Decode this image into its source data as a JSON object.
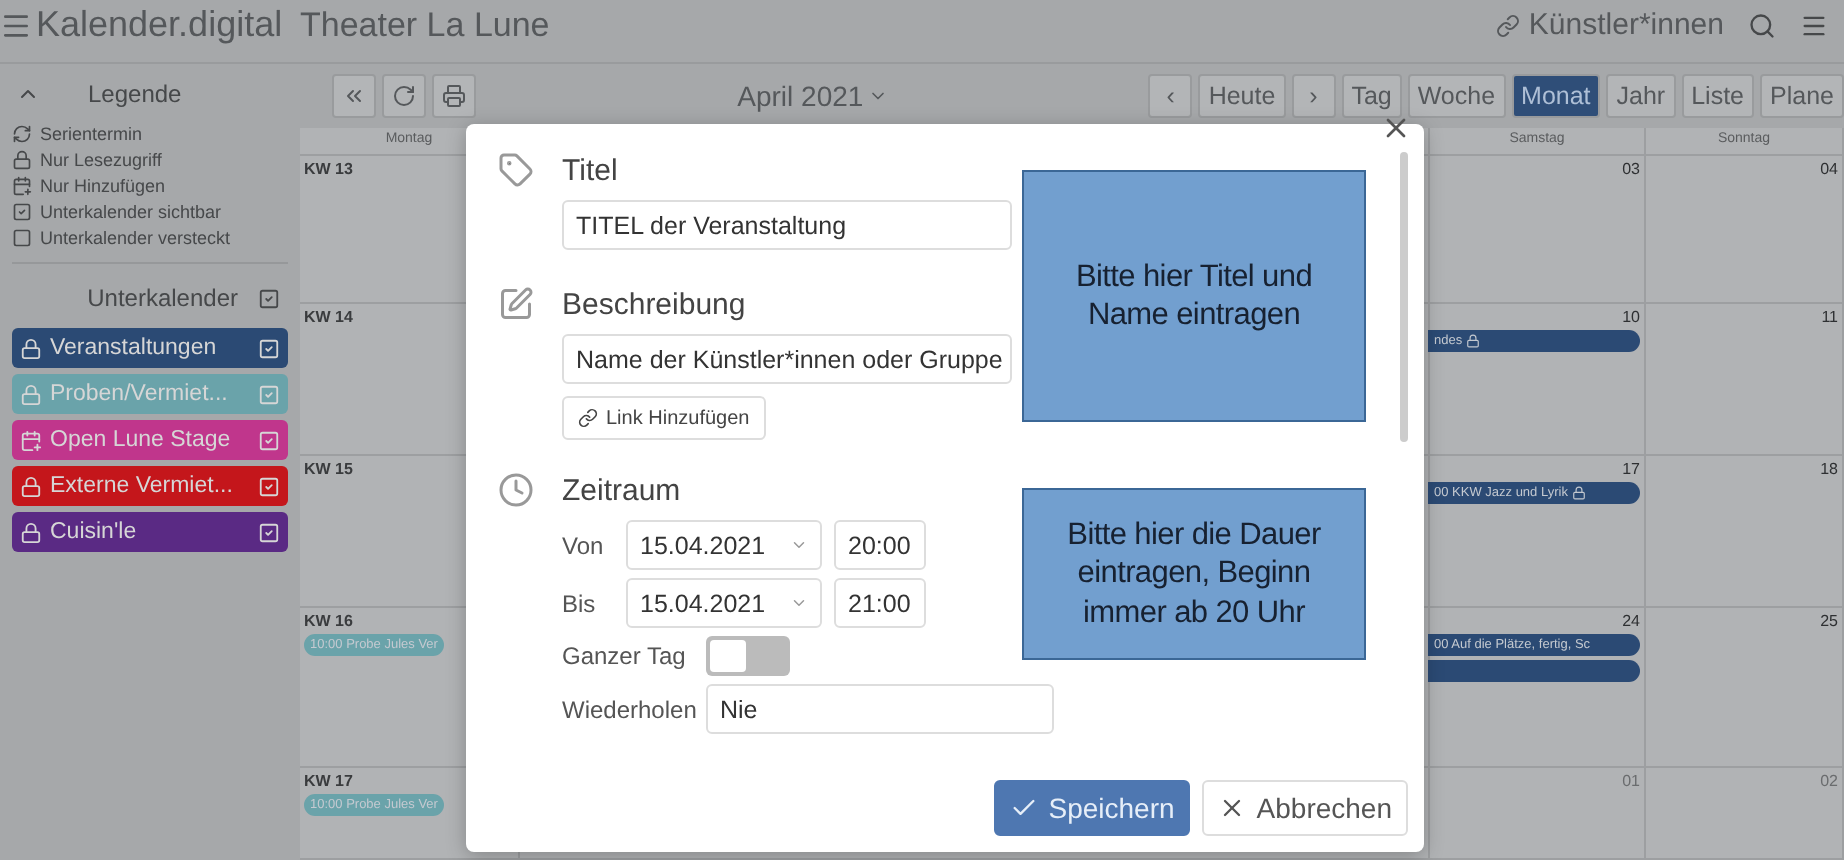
{
  "app": {
    "logo": "Kalender.digital",
    "calendar_name": "Theater La Lune",
    "user_link": "Künstler*innen"
  },
  "sidebar": {
    "legend_title": "Legende",
    "expanded": true,
    "legend": [
      {
        "kind": "series",
        "label": "Serientermin"
      },
      {
        "kind": "readonly",
        "label": "Nur Lesezugriff"
      },
      {
        "kind": "addonly",
        "label": "Nur Hinzufügen"
      },
      {
        "kind": "visible",
        "label": "Unterkalender sichtbar"
      },
      {
        "kind": "hidden",
        "label": "Unterkalender versteckt"
      }
    ],
    "subcalendars_title": "Unterkalender",
    "subcalendars_all_checked": true,
    "subcalendars": [
      {
        "name": "Veranstaltungen",
        "kind": "readonly",
        "color": "#2b4a74",
        "checked": true
      },
      {
        "name": "Proben/Vermiet...",
        "kind": "readonly",
        "color": "#6aa3aa",
        "checked": true
      },
      {
        "name": "Open Lune Stage",
        "kind": "addonly",
        "color": "#c0368c",
        "checked": true
      },
      {
        "name": "Externe Vermiet...",
        "kind": "readonly",
        "color": "#c4161b",
        "checked": true
      },
      {
        "name": "Cuisin'le",
        "kind": "readonly",
        "color": "#5a2a84",
        "checked": true
      }
    ]
  },
  "toolbar": {
    "month": "April 2021",
    "nav": [
      "‹",
      "Heute",
      "›"
    ],
    "views": [
      {
        "label": "Tag",
        "selected": false
      },
      {
        "label": "Woche",
        "selected": false
      },
      {
        "label": "Monat",
        "selected": true
      },
      {
        "label": "Jahr",
        "selected": false
      },
      {
        "label": "Liste",
        "selected": false
      },
      {
        "label": "Plane",
        "selected": false
      }
    ]
  },
  "calendar": {
    "weekdays": {
      "monday": "Montag",
      "saturday": "Samstag",
      "sunday": "Sonntag"
    },
    "weeks": [
      {
        "label": "KW 13",
        "saturday": {
          "date": "03"
        },
        "sunday": {
          "date": "04"
        }
      },
      {
        "label": "KW 14",
        "saturday": {
          "date": "10",
          "events": [
            {
              "text": "ndes",
              "color": "#2b4a74",
              "locked": true
            }
          ]
        },
        "sunday": {
          "date": "11"
        }
      },
      {
        "label": "KW 15",
        "saturday": {
          "date": "17",
          "events": [
            {
              "text": "00 KKW Jazz und Lyrik",
              "color": "#2b4a74",
              "locked": true
            }
          ]
        },
        "sunday": {
          "date": "18"
        }
      },
      {
        "label": "KW 16",
        "monday_events": [
          {
            "text": "10:00 Probe Jules Ver",
            "color": "#6aa3aa"
          }
        ],
        "saturday": {
          "date": "24",
          "events": [
            {
              "text": "00 Auf die Plätze, fertig, Sc",
              "color": "#2b4a74"
            },
            {
              "color": "#2b4a74"
            }
          ]
        },
        "sunday": {
          "date": "25"
        }
      },
      {
        "label": "KW 17",
        "monday_events": [
          {
            "text": "10:00 Probe Jules Ver",
            "color": "#6aa3aa"
          }
        ],
        "saturday": {
          "date": "01",
          "muted": true
        },
        "sunday": {
          "date": "02",
          "muted": true
        }
      }
    ]
  },
  "dialog": {
    "title_label": "Titel",
    "title_value": "TITEL der Veranstaltung",
    "description_label": "Beschreibung",
    "description_value": "Name der Künstler*innen oder Gruppe",
    "add_link": "Link Hinzufügen",
    "period_label": "Zeitraum",
    "from": {
      "label": "Von",
      "date": "15.04.2021",
      "time": "20:00"
    },
    "to": {
      "label": "Bis",
      "date": "15.04.2021",
      "time": "21:00"
    },
    "all_day": {
      "label": "Ganzer Tag",
      "on": false
    },
    "repeat": {
      "label": "Wiederholen",
      "value": "Nie"
    },
    "save": "Speichern",
    "cancel": "Abbrechen"
  },
  "notes": [
    "Bitte hier Titel und Name eintragen",
    "Bitte hier die Dauer eintragen, Beginn immer ab 20 Uhr"
  ]
}
